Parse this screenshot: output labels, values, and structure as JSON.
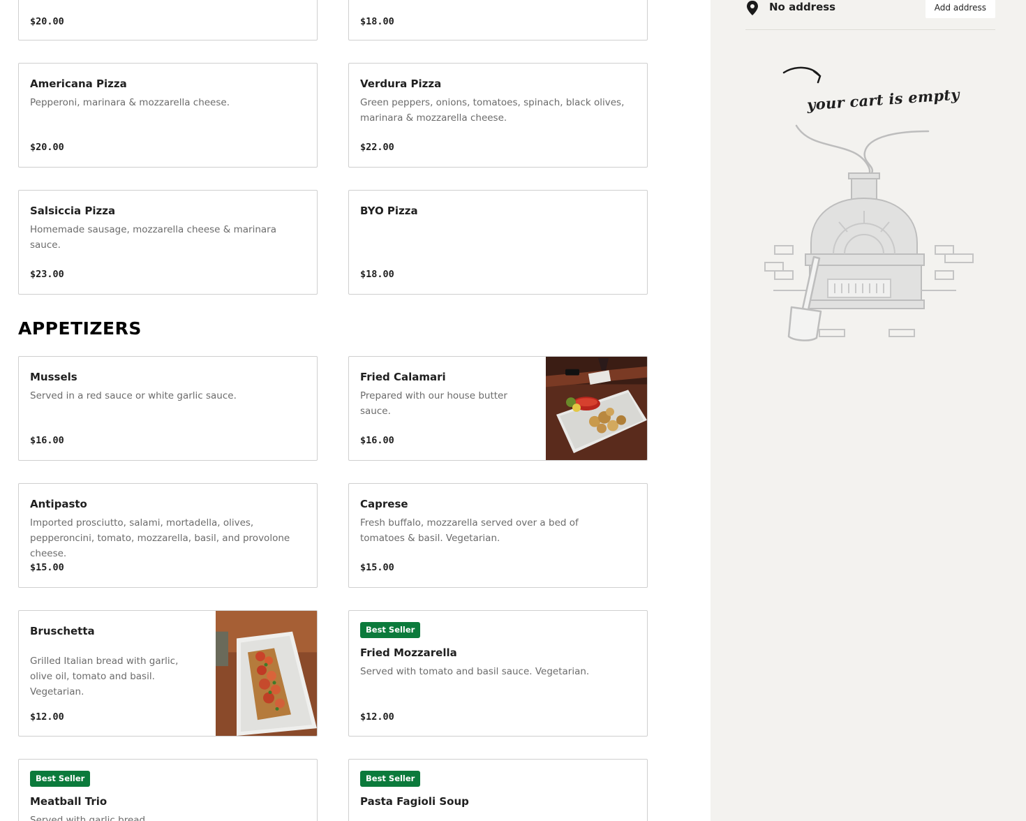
{
  "menu": {
    "section_appetizers": "APPETIZERS",
    "items": [
      {
        "name": "",
        "desc": "",
        "price": "$20.00"
      },
      {
        "name": "",
        "desc": "",
        "price": "$18.00"
      },
      {
        "name": "Americana Pizza",
        "desc": "Pepperoni, marinara & mozzarella cheese.",
        "price": "$20.00"
      },
      {
        "name": "Verdura Pizza",
        "desc": "Green peppers, onions, tomatoes, spinach, black olives, marinara & mozzarella cheese.",
        "price": "$22.00"
      },
      {
        "name": "Salsiccia Pizza",
        "desc": "Homemade sausage, mozzarella cheese & marinara sauce.",
        "price": "$23.00"
      },
      {
        "name": "BYO Pizza",
        "desc": "",
        "price": "$18.00"
      },
      {
        "name": "Mussels",
        "desc": "Served in a red sauce or white garlic sauce.",
        "price": "$16.00"
      },
      {
        "name": "Fried Calamari",
        "desc": "Prepared with our house butter sauce.",
        "price": "$16.00"
      },
      {
        "name": "Antipasto",
        "desc": "Imported prosciutto, salami, mortadella, olives, pepperoncini, tomato, mozzarella, basil, and provolone cheese.",
        "price": "$15.00"
      },
      {
        "name": "Caprese",
        "desc": "Fresh buffalo, mozzarella served over a bed of tomatoes & basil. Vegetarian.",
        "price": "$15.00"
      },
      {
        "name": "Bruschetta",
        "desc": "Grilled Italian bread with garlic, olive oil, tomato and basil. Vegetarian.",
        "price": "$12.00"
      },
      {
        "name": "Fried Mozzarella",
        "desc": "Served with tomato and basil sauce. Vegetarian.",
        "price": "$12.00",
        "badge": "Best Seller"
      },
      {
        "name": "Meatball Trio",
        "desc": "Served with garlic bread.",
        "price": "",
        "badge": "Best Seller"
      },
      {
        "name": "Pasta Fagioli Soup",
        "desc": "",
        "price": "",
        "badge": "Best Seller"
      }
    ]
  },
  "cart": {
    "address_text": "No address",
    "add_address_label": "Add address",
    "empty_text": "your cart is empty",
    "pin_icon": "map-pin-icon"
  },
  "colors": {
    "badge_green": "#0b7a3b",
    "sidebar_bg": "#f3f2ef",
    "card_border": "#cfcfcf"
  }
}
